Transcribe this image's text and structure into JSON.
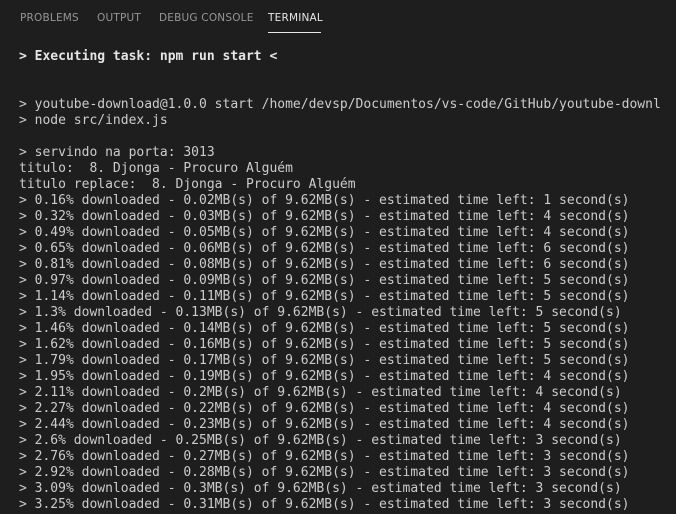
{
  "panel": {
    "tabs": [
      {
        "label": "PROBLEMS",
        "active": false
      },
      {
        "label": "OUTPUT",
        "active": false
      },
      {
        "label": "DEBUG CONSOLE",
        "active": false
      },
      {
        "label": "TERMINAL",
        "active": true
      }
    ]
  },
  "terminal": {
    "lines": [
      "> Executing task: npm run start <",
      "> youtube-download@1.0.0 start /home/devsp/Documentos/vs-code/GitHub/youtube-downl",
      "> node src/index.js",
      "> servindo na porta: 3013",
      "titulo:  8. Djonga - Procuro Alguém",
      "titulo replace:  8. Djonga - Procuro Alguém",
      "> 0.16% downloaded - 0.02MB(s) of 9.62MB(s) - estimated time left: 1 second(s)",
      "> 0.32% downloaded - 0.03MB(s) of 9.62MB(s) - estimated time left: 4 second(s)",
      "> 0.49% downloaded - 0.05MB(s) of 9.62MB(s) - estimated time left: 4 second(s)",
      "> 0.65% downloaded - 0.06MB(s) of 9.62MB(s) - estimated time left: 6 second(s)",
      "> 0.81% downloaded - 0.08MB(s) of 9.62MB(s) - estimated time left: 6 second(s)",
      "> 0.97% downloaded - 0.09MB(s) of 9.62MB(s) - estimated time left: 5 second(s)",
      "> 1.14% downloaded - 0.11MB(s) of 9.62MB(s) - estimated time left: 5 second(s)",
      "> 1.3% downloaded - 0.13MB(s) of 9.62MB(s) - estimated time left: 5 second(s)",
      "> 1.46% downloaded - 0.14MB(s) of 9.62MB(s) - estimated time left: 5 second(s)",
      "> 1.62% downloaded - 0.16MB(s) of 9.62MB(s) - estimated time left: 5 second(s)",
      "> 1.79% downloaded - 0.17MB(s) of 9.62MB(s) - estimated time left: 5 second(s)",
      "> 1.95% downloaded - 0.19MB(s) of 9.62MB(s) - estimated time left: 4 second(s)",
      "> 2.11% downloaded - 0.2MB(s) of 9.62MB(s) - estimated time left: 4 second(s)",
      "> 2.27% downloaded - 0.22MB(s) of 9.62MB(s) - estimated time left: 4 second(s)",
      "> 2.44% downloaded - 0.23MB(s) of 9.62MB(s) - estimated time left: 4 second(s)",
      "> 2.6% downloaded - 0.25MB(s) of 9.62MB(s) - estimated time left: 3 second(s)",
      "> 2.76% downloaded - 0.27MB(s) of 9.62MB(s) - estimated time left: 3 second(s)",
      "> 2.92% downloaded - 0.28MB(s) of 9.62MB(s) - estimated time left: 3 second(s)",
      "> 3.09% downloaded - 0.3MB(s) of 9.62MB(s) - estimated time left: 3 second(s)",
      "> 3.25% downloaded - 0.31MB(s) of 9.62MB(s) - estimated time left: 3 second(s)"
    ]
  }
}
